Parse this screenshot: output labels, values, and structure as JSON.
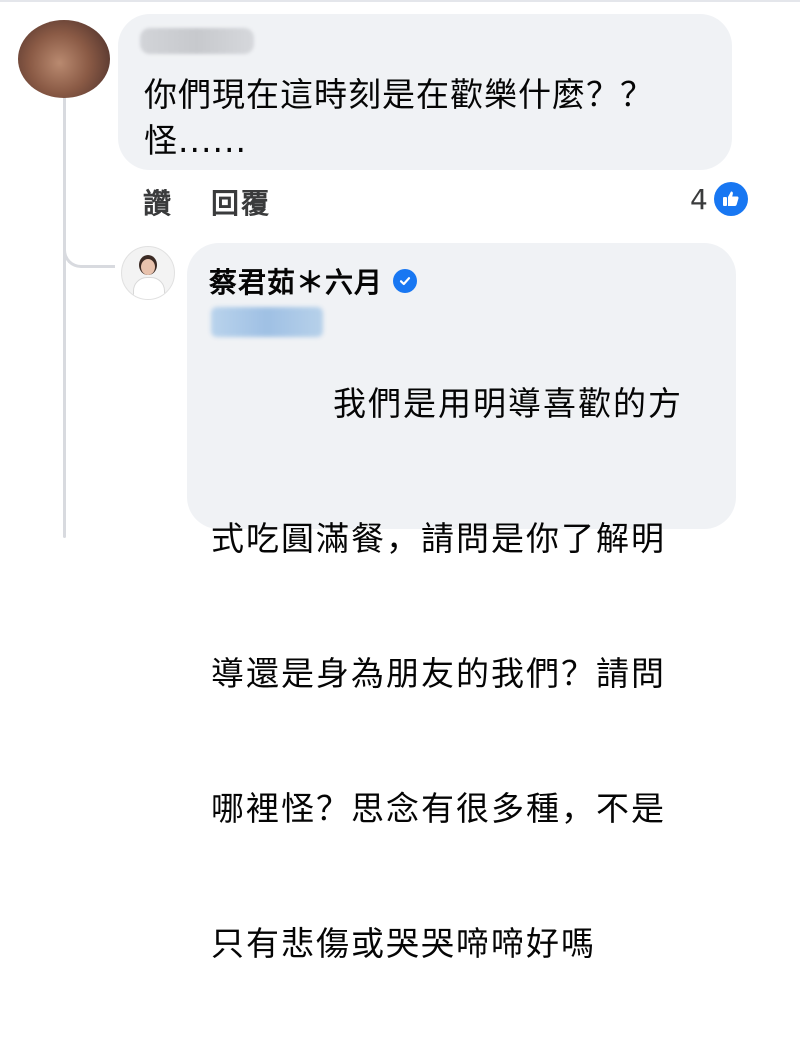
{
  "comment1": {
    "text_line1": "你們現在這時刻是在歡樂什麼？？",
    "text_line2": "怪......",
    "actions": {
      "like": "讚",
      "reply": "回覆"
    },
    "reaction_count": "4"
  },
  "reply": {
    "author": "蔡君茹＊六月",
    "lines": [
      "我們是用明導喜歡的方",
      "式吃圓滿餐，請問是你了解明",
      "導還是身為朋友的我們？請問",
      "哪裡怪？思念有很多種，不是",
      "只有悲傷或哭哭啼啼好嗎"
    ]
  },
  "colors": {
    "bubble": "#f0f2f5",
    "accent": "#1877f2",
    "text": "#050505",
    "muted": "#3a3b3c"
  },
  "icons": {
    "reaction": "like-thumb-icon",
    "badge": "verified-check-icon"
  }
}
